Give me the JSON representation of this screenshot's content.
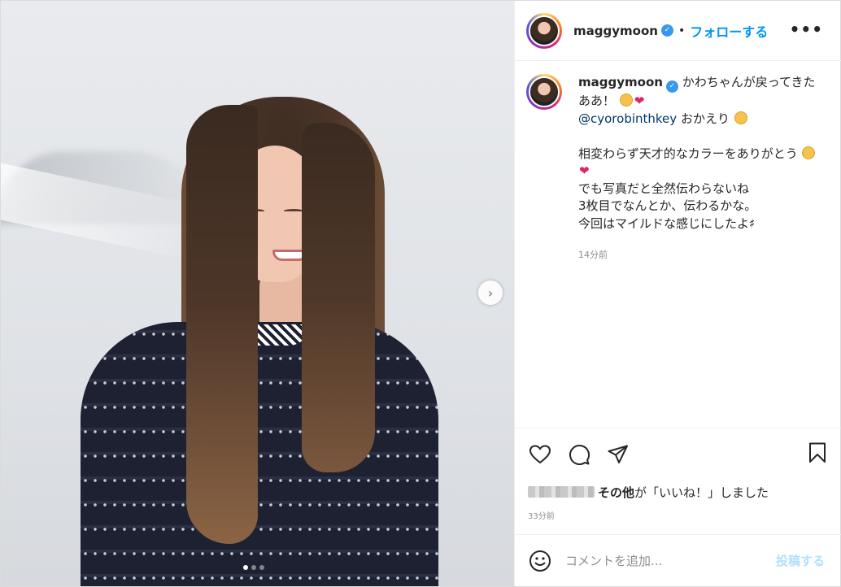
{
  "author": {
    "username": "maggymoon",
    "verified_icon": "verified-badge-icon",
    "separator": "•",
    "follow_label": "フォローする",
    "more_label": "•••"
  },
  "caption": {
    "username": "maggymoon",
    "line1": "かわちゃんが戻ってきたああ！",
    "mention": "@cyorobinthkey",
    "mention_suffix": " おかえり",
    "line3": "相変わらず天才的なカラーをありがとう",
    "line4": "でも写真だと全然伝わらないね",
    "line5": "3枚目でなんとか、伝わるかな。",
    "line6": "今回はマイルドな感じにしたよ♯",
    "time": "14分前"
  },
  "likes": {
    "others": "その他",
    "text": "が「いいね！」しました",
    "time": "33分前"
  },
  "comment": {
    "placeholder": "コメントを追加...",
    "post_label": "投稿する"
  },
  "carousel": {
    "next_label": "›",
    "dots": 3,
    "active_dot": 1
  },
  "colors": {
    "accent": "#0095f6",
    "post_disabled": "#b2dffc",
    "verified": "#3897f0",
    "heart": "#e0245e"
  }
}
